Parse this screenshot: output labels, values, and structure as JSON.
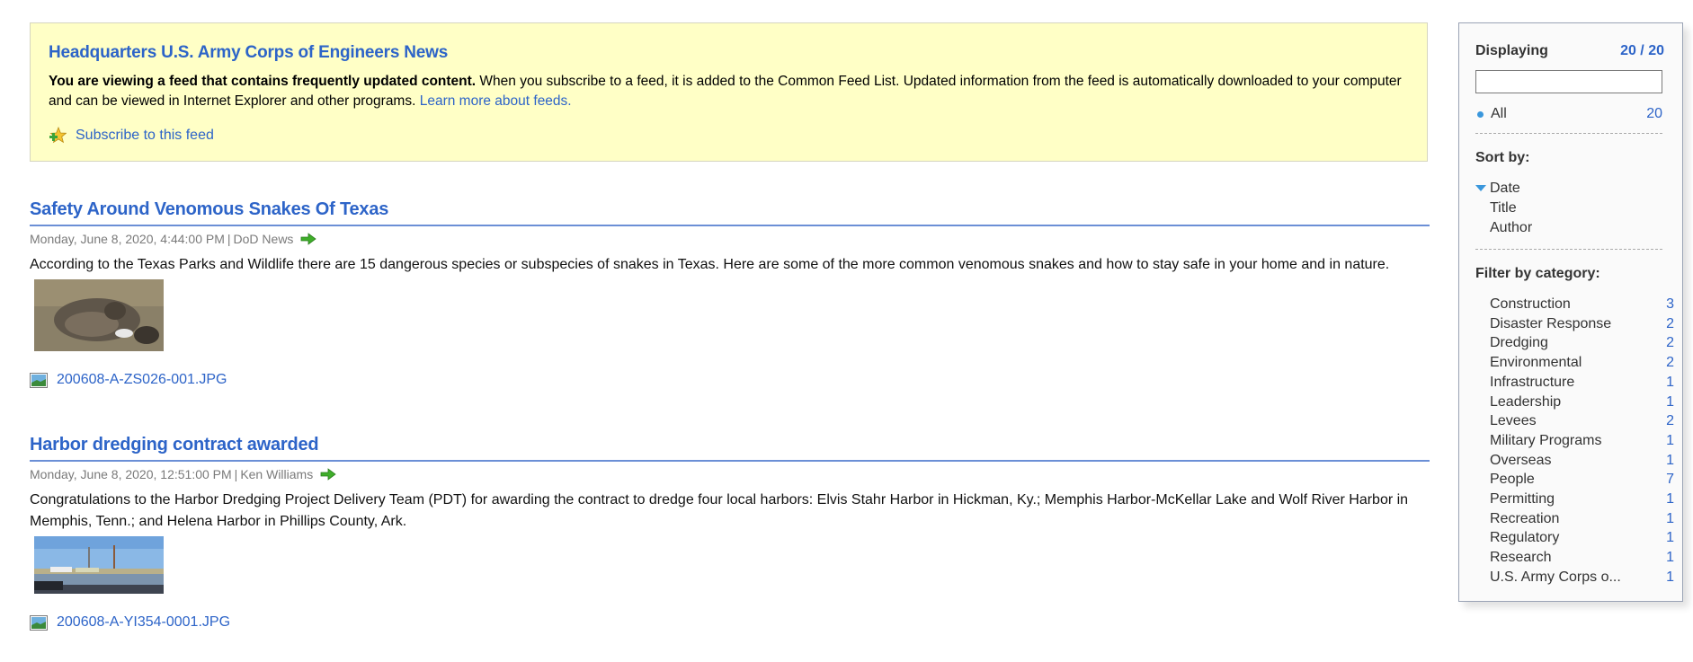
{
  "banner": {
    "title": "Headquarters U.S. Army Corps of Engineers News",
    "intro_bold": "You are viewing a feed that contains frequently updated content.",
    "intro_text": " When you subscribe to a feed, it is added to the Common Feed List. Updated information from the feed is automatically downloaded to your computer and can be viewed in Internet Explorer and other programs. ",
    "learn_more_link": "Learn more about feeds.",
    "subscribe_link": "Subscribe to this feed",
    "subscribe_icon": "subscribe-star-icon"
  },
  "articles": [
    {
      "title": "Safety Around Venomous Snakes Of Texas",
      "date": "Monday, June 8, 2020, 4:44:00 PM",
      "separator": "|",
      "author": "DoD News",
      "body": "According to the Texas Parks and Wildlife there are 15 dangerous species or subspecies of snakes in Texas. Here are some of the more common venomous snakes and how to stay safe in your home and in nature.",
      "thumbnail": "rattlesnake-photo",
      "attachment": "200608-A-ZS026-001.JPG"
    },
    {
      "title": "Harbor dredging contract awarded",
      "date": "Monday, June 8, 2020, 12:51:00 PM",
      "separator": "|",
      "author": "Ken Williams",
      "body": "Congratulations to the Harbor Dredging Project Delivery Team (PDT) for awarding the contract to dredge four local harbors: Elvis Stahr Harbor in Hickman, Ky.; Memphis Harbor-McKellar Lake and Wolf River Harbor in Memphis, Tenn.; and Helena Harbor in Phillips County, Ark.",
      "thumbnail": "harbor-photo",
      "attachment": "200608-A-YI354-0001.JPG"
    }
  ],
  "sidebar": {
    "displaying_label": "Displaying",
    "displaying_count": "20 / 20",
    "search_value": "",
    "all_label": "All",
    "all_count": "20",
    "sort_title": "Sort by:",
    "sort_options": [
      "Date",
      "Title",
      "Author"
    ],
    "sort_selected": "Date",
    "filter_title": "Filter by category:",
    "categories": [
      {
        "name": "Construction",
        "count": "3"
      },
      {
        "name": "Disaster Response",
        "count": "2"
      },
      {
        "name": "Dredging",
        "count": "2"
      },
      {
        "name": "Environmental",
        "count": "2"
      },
      {
        "name": "Infrastructure",
        "count": "1"
      },
      {
        "name": "Leadership",
        "count": "1"
      },
      {
        "name": "Levees",
        "count": "2"
      },
      {
        "name": "Military Programs",
        "count": "1"
      },
      {
        "name": "Overseas",
        "count": "1"
      },
      {
        "name": "People",
        "count": "7"
      },
      {
        "name": "Permitting",
        "count": "1"
      },
      {
        "name": "Recreation",
        "count": "1"
      },
      {
        "name": "Regulatory",
        "count": "1"
      },
      {
        "name": "Research",
        "count": "1"
      },
      {
        "name": "U.S. Army Corps o...",
        "count": "1"
      }
    ]
  },
  "colors": {
    "link": "#2d64c8",
    "banner_bg": "#ffffc6",
    "accent_blue": "#3a97dc"
  }
}
